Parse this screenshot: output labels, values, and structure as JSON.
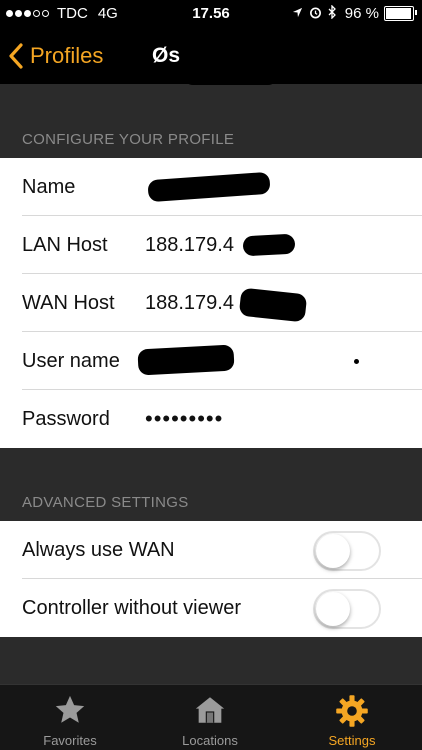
{
  "status_bar": {
    "carrier": "TDC",
    "network": "4G",
    "time": "17.56",
    "battery_percent": "96 %",
    "battery_level": 0.96
  },
  "nav": {
    "back_label": "Profiles",
    "title_visible": "Øs"
  },
  "sections": {
    "configure": {
      "header": "CONFIGURE YOUR PROFILE",
      "rows": [
        {
          "label": "Name",
          "value": ""
        },
        {
          "label": "LAN Host",
          "value": "188.179.4"
        },
        {
          "label": "WAN Host",
          "value": "188.179.4"
        },
        {
          "label": "User name",
          "value": ""
        },
        {
          "label": "Password",
          "value": "•••••••••"
        }
      ]
    },
    "advanced": {
      "header": "ADVANCED SETTINGS",
      "rows": [
        {
          "label": "Always use WAN",
          "toggle": false
        },
        {
          "label": "Controller without viewer",
          "toggle": false
        }
      ]
    }
  },
  "tab_bar": {
    "tabs": [
      {
        "label": "Favorites",
        "icon": "star-icon",
        "active": false
      },
      {
        "label": "Locations",
        "icon": "house-icon",
        "active": false
      },
      {
        "label": "Settings",
        "icon": "gear-icon",
        "active": true
      }
    ]
  },
  "colors": {
    "accent": "#f5a623",
    "background": "#2b2b2b",
    "bar_background": "#000000"
  }
}
